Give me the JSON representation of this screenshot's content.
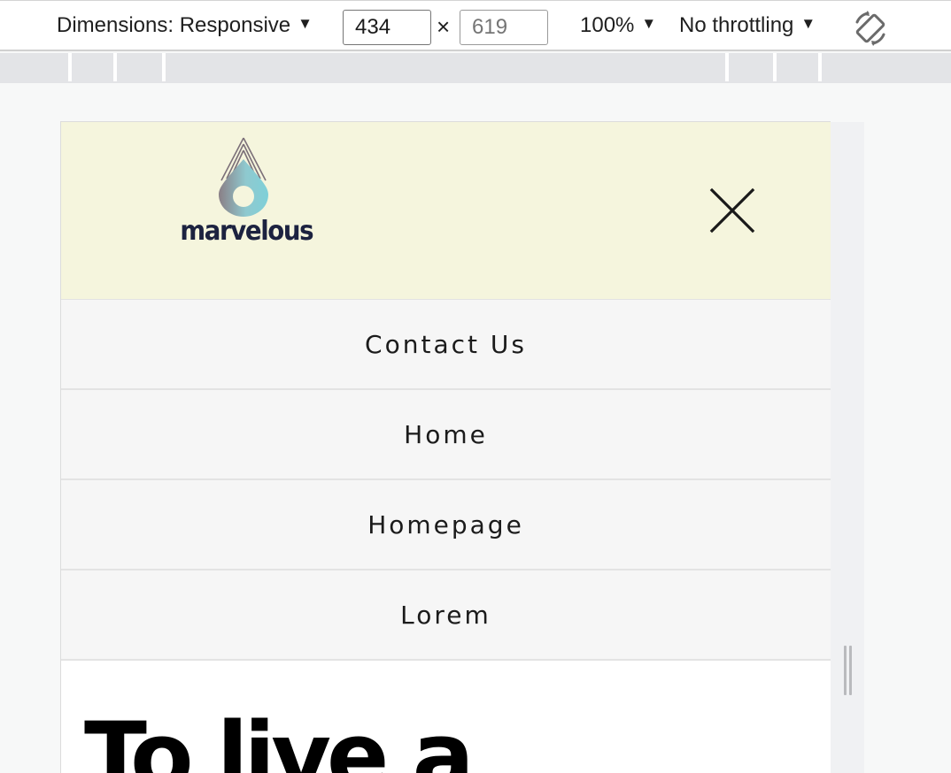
{
  "devtools": {
    "dimensions_label": "Dimensions: Responsive",
    "width_value": "434",
    "times": "×",
    "height_placeholder": "619",
    "zoom": "100%",
    "throttling": "No throttling",
    "caret": "▼"
  },
  "site": {
    "logo_text": "marvelous",
    "menu": [
      {
        "label": "Contact Us"
      },
      {
        "label": "Home"
      },
      {
        "label": "Homepage"
      },
      {
        "label": "Lorem"
      }
    ],
    "hero_text": "To live a"
  }
}
